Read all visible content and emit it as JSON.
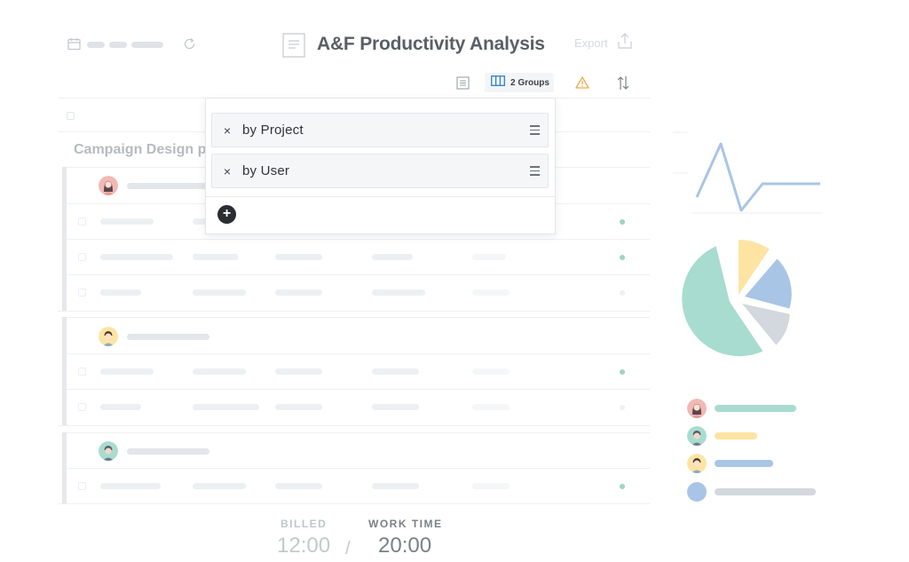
{
  "header": {
    "title": "A&F Productivity Analysis",
    "export_label": "Export"
  },
  "toolbar": {
    "groups_label": "2 Groups"
  },
  "group_heading": "Campaign Design p",
  "groups_dropdown": {
    "items": [
      {
        "remove": "×",
        "label": "by Project"
      },
      {
        "remove": "×",
        "label": "by User"
      }
    ],
    "add_symbol": "+"
  },
  "footer": {
    "billed_label": "BILLED",
    "billed_value": "12:00",
    "separator": "/",
    "worktime_label": "WORK TIME",
    "worktime_value": "20:00"
  },
  "colors": {
    "teal": "#a8dcd0",
    "yellow": "#fde4a3",
    "blue": "#a9c5e6",
    "gray": "#d3d8de",
    "accent": "#2c82c9",
    "warning": "#f0a84b"
  },
  "icons": [
    "calendar-icon",
    "refresh-icon",
    "document-icon",
    "upload-icon",
    "list-icon",
    "columns-icon",
    "warning-icon",
    "sort-icon",
    "close-icon",
    "drag-handle-icon",
    "plus-icon"
  ]
}
